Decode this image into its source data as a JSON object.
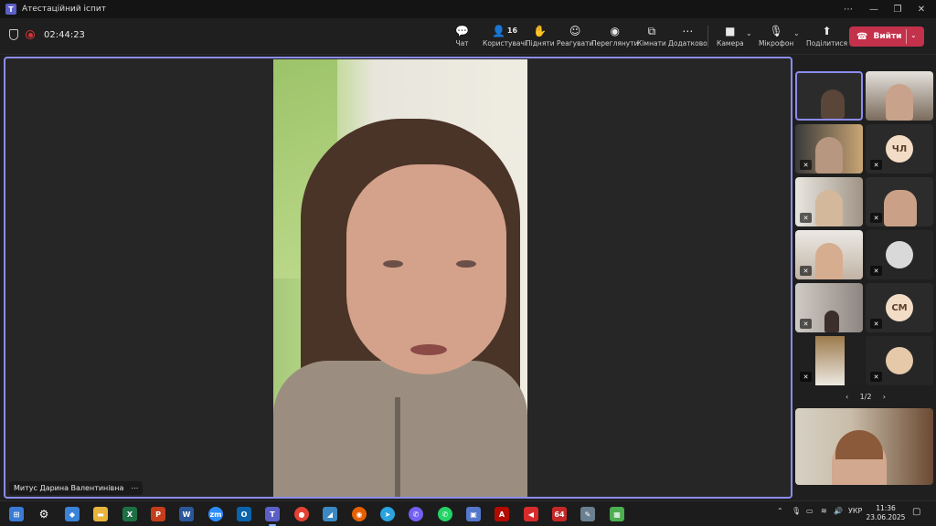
{
  "window": {
    "title": "Атестаційний іспит"
  },
  "toolbar": {
    "timer": "02:44:23",
    "participants_count": "16",
    "buttons": {
      "chat": "Чат",
      "people": "Користувачі",
      "raise": "Підняти",
      "react": "Реагувати",
      "view": "Переглянути",
      "rooms": "Кімнати",
      "more": "Додатково",
      "camera": "Камера",
      "mic": "Мікрофон",
      "share": "Поділитися"
    },
    "leave_label": "Вийти"
  },
  "stage": {
    "speaker_name": "Митус Дарина Валентинівна"
  },
  "gallery": {
    "initials": [
      "ЧЛ",
      "СМ"
    ],
    "page": "1/2"
  },
  "taskbar": {
    "language": "УКР",
    "time": "11:36",
    "date": "23.06.2025",
    "badge_64": "64"
  },
  "colors": {
    "accent": "#8b8cf0",
    "leave": "#c4314b",
    "teams": "#5b5fc7",
    "record": "#d13438"
  }
}
